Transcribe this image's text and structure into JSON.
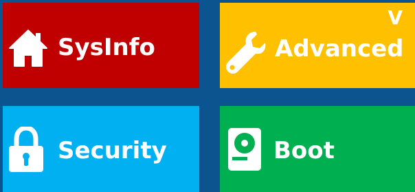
{
  "colors": {
    "background": "#0c5490",
    "sysinfo": "#c00000",
    "advanced": "#ffc000",
    "security": "#00b0f0",
    "boot": "#00b050",
    "text": "#ffffff"
  },
  "tiles": {
    "sysinfo": {
      "label": "SysInfo",
      "icon": "home-icon"
    },
    "advanced": {
      "label": "Advanced",
      "icon": "wrench-icon",
      "corner": "V"
    },
    "security": {
      "label": "Security",
      "icon": "lock-icon"
    },
    "boot": {
      "label": "Boot",
      "icon": "disk-icon"
    }
  }
}
